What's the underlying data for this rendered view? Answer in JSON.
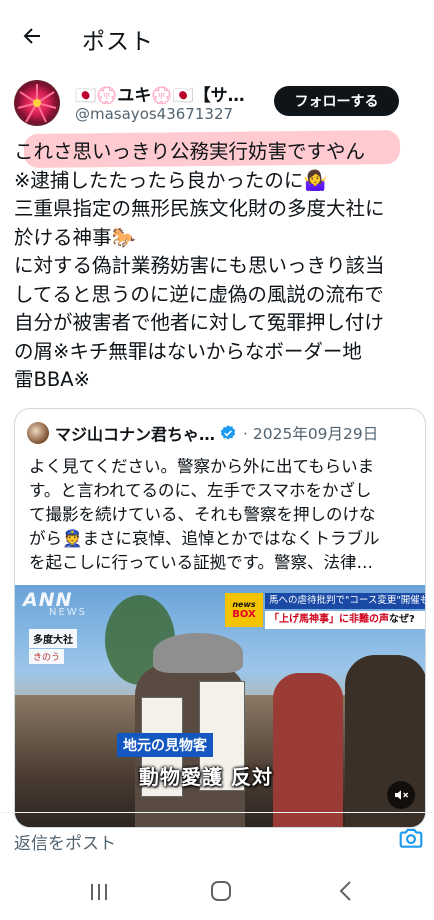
{
  "header": {
    "title": "ポスト"
  },
  "author": {
    "display_name": "🇯🇵💮ユキ💮🇯🇵【サ…",
    "handle": "@masayos43671327",
    "follow_label": "フォローする"
  },
  "post": {
    "text": "これさ思いっきり公務実行妨害ですやん\n※逮捕したたったら良かったのに🤷‍♀️\n三重県指定の無形民族文化財の多度大社に\n於ける神事🐎\nに対する偽計業務妨害にも思いっきり該当\nしてると思うのに逆に虚偽の風説の流布で\n自分が被害者で他者に対して冤罪押し付け\nの屑※キチ無罪はないからなボーダー地\n雷BBA※"
  },
  "quote": {
    "name": "マジ山コナン君ちゃ…",
    "date": "· 2025年09月29日",
    "text": "よく見てください。警察から外に出てもらいま\nす。と言われてるのに、左手でスマホをかざし\nて撮影を続けている、それも警察を押しのけな\nがら👮まさに哀悼、追悼とかではなくトラブル\nを起こしに行っている証拠です。警察、法律…"
  },
  "media": {
    "ann_logo": "ANN",
    "ann_sub": "NEWS",
    "location": "多度大社",
    "location_sub": "きのう",
    "newsbox_top": "news",
    "newsbox_bottom": "BOX",
    "headline1": "馬への虐待批判で\"コース変更\"開催も…",
    "headline2_red": "「上げ馬神事」に非難の声",
    "headline2_rest": "なぜ?",
    "caption": "地元の見物客",
    "subtitle": "動物愛護 反対"
  },
  "reply": {
    "placeholder": "返信をポスト"
  },
  "colors": {
    "text": "#0f1419",
    "secondary": "#536471",
    "verified": "#1d9bf0",
    "highlight": "#ff8c96"
  },
  "icons": {
    "back": "arrow-left-icon",
    "verified": "verified-badge-icon",
    "mute": "mute-icon",
    "camera": "camera-icon",
    "nav_recent": "recent-apps-icon",
    "nav_home": "home-icon",
    "nav_back": "chevron-left-icon"
  }
}
